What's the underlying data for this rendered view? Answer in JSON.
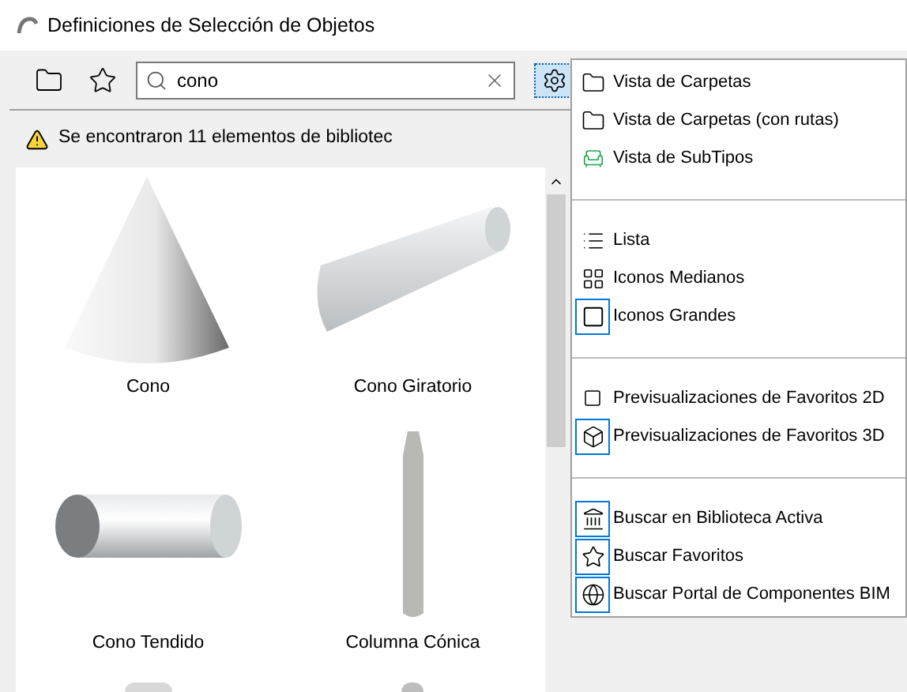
{
  "window": {
    "title": "Definiciones de Selección de Objetos"
  },
  "search": {
    "value": "cono"
  },
  "status": {
    "message": "Se encontraron 11 elementos de bibliotec"
  },
  "tiles": [
    {
      "label": "Cono"
    },
    {
      "label": "Cono Giratorio"
    },
    {
      "label": "Cono Tendido"
    },
    {
      "label": "Columna Cónica"
    }
  ],
  "menu": {
    "sections": [
      {
        "items": [
          {
            "label": "Vista de Carpetas",
            "selected": false
          },
          {
            "label": "Vista de Carpetas (con rutas)",
            "selected": false
          },
          {
            "label": "Vista de SubTipos",
            "selected": false
          }
        ]
      },
      {
        "items": [
          {
            "label": "Lista",
            "selected": false
          },
          {
            "label": "Iconos Medianos",
            "selected": false
          },
          {
            "label": "Iconos Grandes",
            "selected": true
          }
        ]
      },
      {
        "items": [
          {
            "label": "Previsualizaciones de Favoritos 2D",
            "selected": false
          },
          {
            "label": "Previsualizaciones de Favoritos 3D",
            "selected": true
          }
        ]
      },
      {
        "items": [
          {
            "label": "Buscar en Biblioteca Activa",
            "selected": true
          },
          {
            "label": "Buscar Favoritos",
            "selected": true
          },
          {
            "label": "Buscar Portal de Componentes BIM",
            "selected": true
          }
        ]
      }
    ]
  }
}
